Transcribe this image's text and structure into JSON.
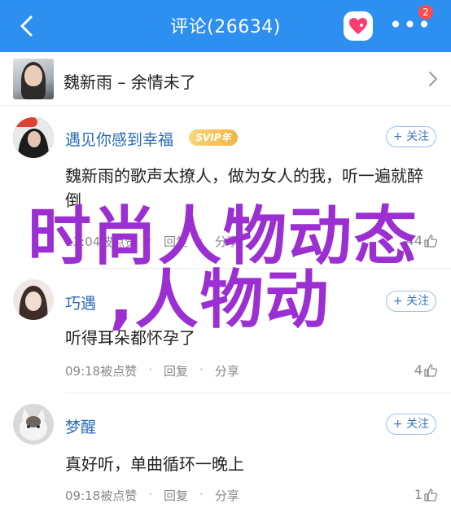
{
  "header": {
    "title": "评论(26634)",
    "more_icon": "more-dots-icon",
    "badge_count": "2",
    "heart_color": "#ff3c6e",
    "bg_color": "#2d8ff0"
  },
  "song": {
    "title": "魏新雨 – 余情未了"
  },
  "comments": [
    {
      "name": "遇见你感到幸福",
      "badge": "SVIP年",
      "follow": "+ 关注",
      "text": "魏新雨的歌声太撩人，做为女人的我，听一遍就醉倒",
      "time": "13:04被点赞",
      "reply": "回复",
      "share": "分享",
      "likes": "44"
    },
    {
      "name": "巧遇",
      "follow": "+ 关注",
      "text": "听得耳朵都怀孕了",
      "time": "09:18被点赞",
      "reply": "回复",
      "share": "分享",
      "likes": "4"
    },
    {
      "name": "梦醒",
      "follow": "+ 关注",
      "text": "真好听，单曲循环一晚上",
      "time": "09:18被点赞",
      "reply": "回复",
      "share": "分享",
      "likes": "1"
    }
  ],
  "overlay": {
    "line1": "时尚人物动态",
    "line2": ",人物动",
    "color": "#9b2fd1"
  },
  "sep": "·"
}
